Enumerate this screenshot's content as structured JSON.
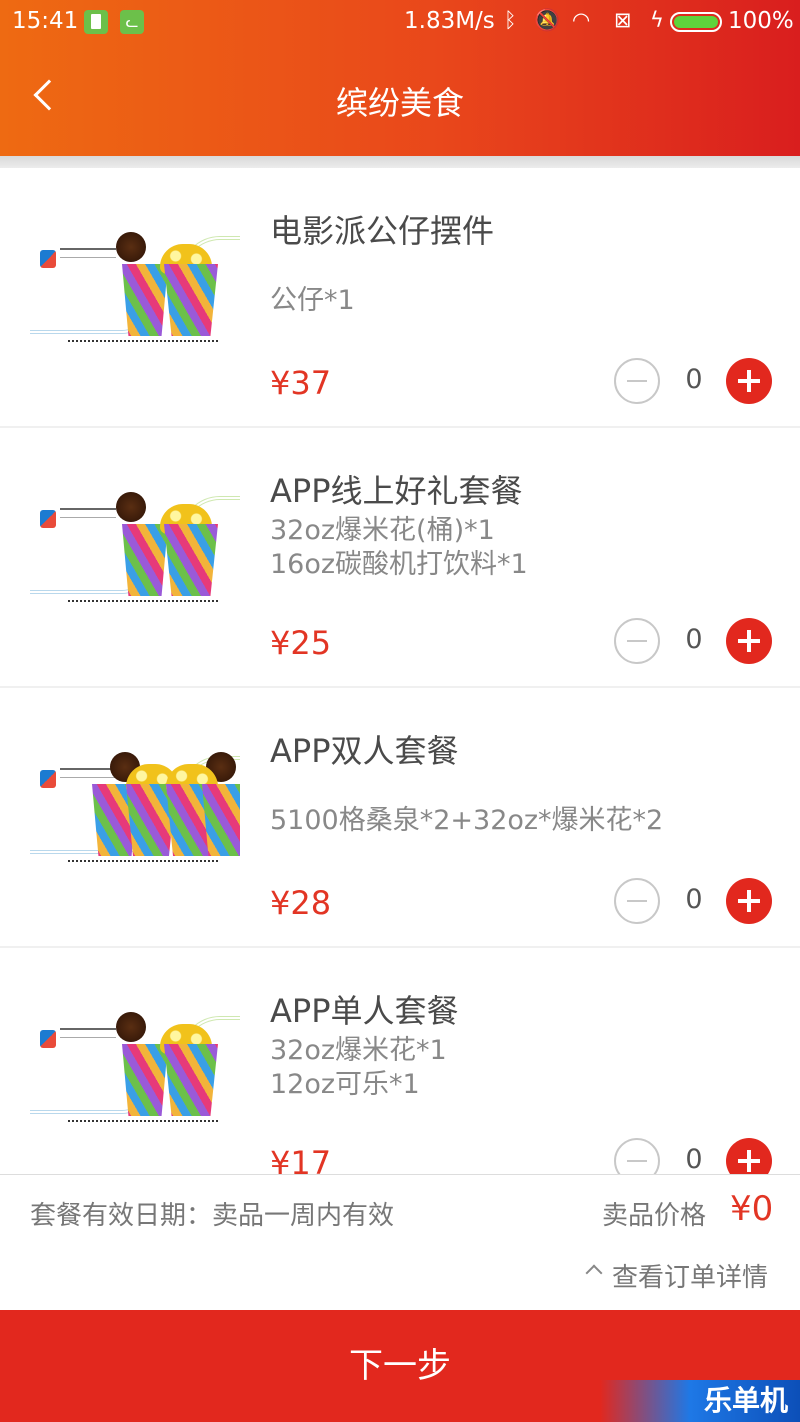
{
  "status_bar": {
    "time": "15:41",
    "network_speed": "1.83M/s",
    "battery_percent": "100%",
    "icons": [
      "battery-app-icon",
      "cat-app-icon",
      "bluetooth-icon",
      "mute-icon",
      "wifi-icon",
      "sim-icon",
      "charging-icon",
      "battery-icon"
    ]
  },
  "header": {
    "title": "缤纷美食",
    "back_icon": "back-arrow-icon",
    "gradient_colors": [
      "#ee6a12",
      "#d91e1e"
    ]
  },
  "products": [
    {
      "name": "电影派公仔摆件",
      "desc_lines": [
        "公仔*1"
      ],
      "price": "¥37",
      "quantity": "0"
    },
    {
      "name": "APP线上好礼套餐",
      "desc_lines": [
        "32oz爆米花(桶)*1",
        "16oz碳酸机打饮料*1"
      ],
      "price": "¥25",
      "quantity": "0"
    },
    {
      "name": "APP双人套餐",
      "desc_lines": [
        "5100格桑泉*2+32oz*爆米花*2"
      ],
      "price": "¥28",
      "quantity": "0"
    },
    {
      "name": "APP单人套餐",
      "desc_lines": [
        "32oz爆米花*1",
        "12oz可乐*1"
      ],
      "price": "¥17",
      "quantity": "0"
    }
  ],
  "footer": {
    "validity": "套餐有效日期：卖品一周内有效",
    "total_label": "卖品价格",
    "total_value": "¥0",
    "detail_link": "查看订单详情"
  },
  "next_button": "下一步",
  "watermark": "乐单机",
  "colors": {
    "accent": "#e2281e",
    "price": "#e23524"
  }
}
